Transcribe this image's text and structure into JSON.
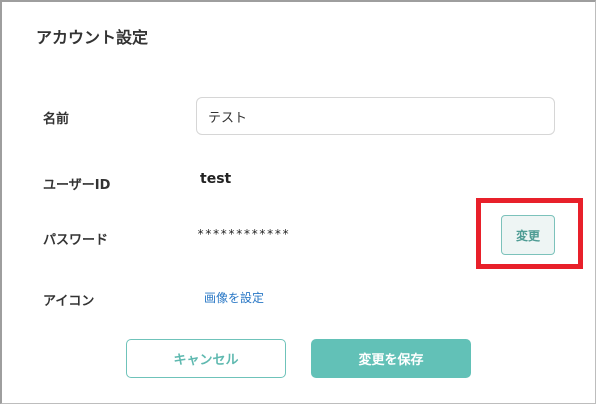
{
  "dialog": {
    "title": "アカウント設定"
  },
  "fields": {
    "name": {
      "label": "名前",
      "value": "テスト"
    },
    "user_id": {
      "label": "ユーザーID",
      "value": "test"
    },
    "password": {
      "label": "パスワード",
      "value": "************",
      "change_label": "変更"
    },
    "icon": {
      "label": "アイコン",
      "link_text": "画像を設定"
    }
  },
  "actions": {
    "cancel_label": "キャンセル",
    "save_label": "変更を保存"
  },
  "colors": {
    "accent": "#62c1b7",
    "link": "#2a78c6",
    "highlight": "#e8202a"
  }
}
